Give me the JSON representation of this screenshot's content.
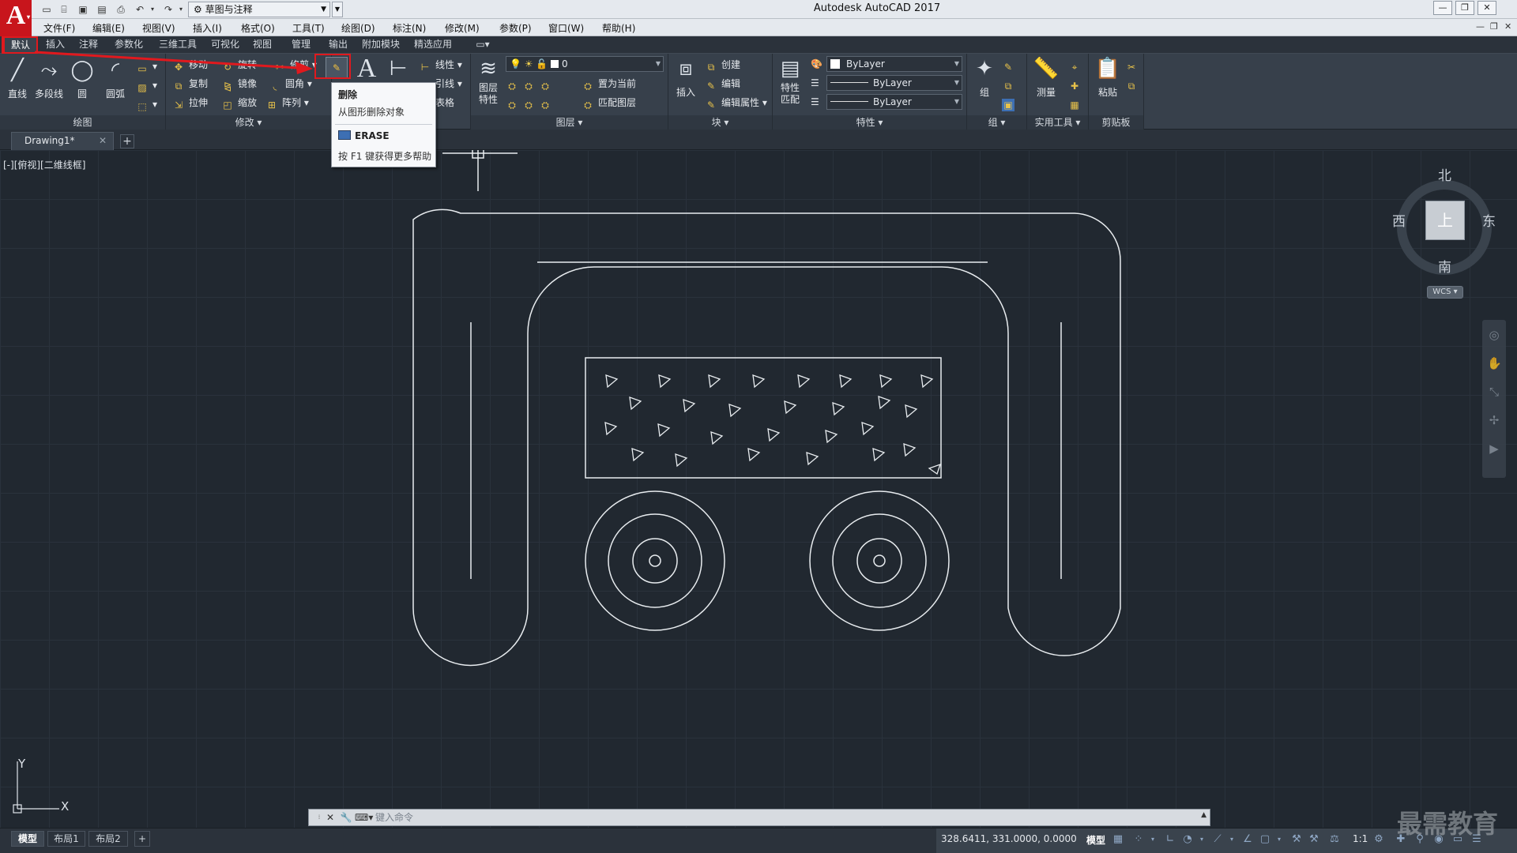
{
  "title_bar": {
    "app_title": "Autodesk AutoCAD 2017",
    "logo_letter": "A",
    "workspace": "草图与注释",
    "window_buttons": [
      "—",
      "❐",
      "✕"
    ]
  },
  "menu": [
    "文件(F)",
    "编辑(E)",
    "视图(V)",
    "插入(I)",
    "格式(O)",
    "工具(T)",
    "绘图(D)",
    "标注(N)",
    "修改(M)",
    "参数(P)",
    "窗口(W)",
    "帮助(H)"
  ],
  "ribbon_tabs": [
    "默认",
    "插入",
    "注释",
    "参数化",
    "三维工具",
    "可视化",
    "视图",
    "管理",
    "输出",
    "附加模块",
    "精选应用"
  ],
  "ribbon": {
    "draw": {
      "title": "绘图",
      "tools": [
        "直线",
        "多段线",
        "圆",
        "圆弧"
      ]
    },
    "modify": {
      "title": "修改",
      "tools": [
        "移动",
        "旋转",
        "修剪",
        "复制",
        "镜像",
        "圆角",
        "拉伸",
        "缩放",
        "阵列"
      ]
    },
    "annotation": {
      "tools": [
        "线性",
        "引线",
        "表格"
      ]
    },
    "layers": {
      "title": "图层",
      "big_label": "图层\n特性",
      "current_layer": "0",
      "tools": [
        "置为当前",
        "匹配图层"
      ]
    },
    "block": {
      "title": "块",
      "insert": "插入",
      "tools": [
        "创建",
        "编辑",
        "编辑属性"
      ]
    },
    "properties": {
      "title": "特性",
      "match": "特性\n匹配",
      "color": "ByLayer",
      "linetype": "ByLayer",
      "lineweight": "ByLayer"
    },
    "groups": {
      "title": "组",
      "label": "组"
    },
    "utilities": {
      "title": "实用工具",
      "label": "测量"
    },
    "clipboard": {
      "title": "剪贴板",
      "label": "粘贴"
    }
  },
  "tooltip": {
    "title": "删除",
    "description": "从图形删除对象",
    "command": "ERASE",
    "help": "按 F1 键获得更多帮助"
  },
  "document_tab": "Drawing1*",
  "view_label": "[-][俯视][二维线框]",
  "viewcube": {
    "north": "北",
    "south": "南",
    "east": "东",
    "west": "西",
    "top": "上",
    "wcs": "WCS"
  },
  "ucs": {
    "x": "X",
    "y": "Y"
  },
  "command_line": {
    "placeholder": "键入命令"
  },
  "layout_tabs": [
    "模型",
    "布局1",
    "布局2"
  ],
  "status": {
    "coords": "328.6411, 331.0000, 0.0000",
    "mode": "模型",
    "scale": "1:1"
  },
  "watermark": "最需教育",
  "colors": {
    "accent_red": "#e0191e",
    "canvas": "#212830",
    "ribbon": "#37404b",
    "line": "#e8ecef"
  }
}
